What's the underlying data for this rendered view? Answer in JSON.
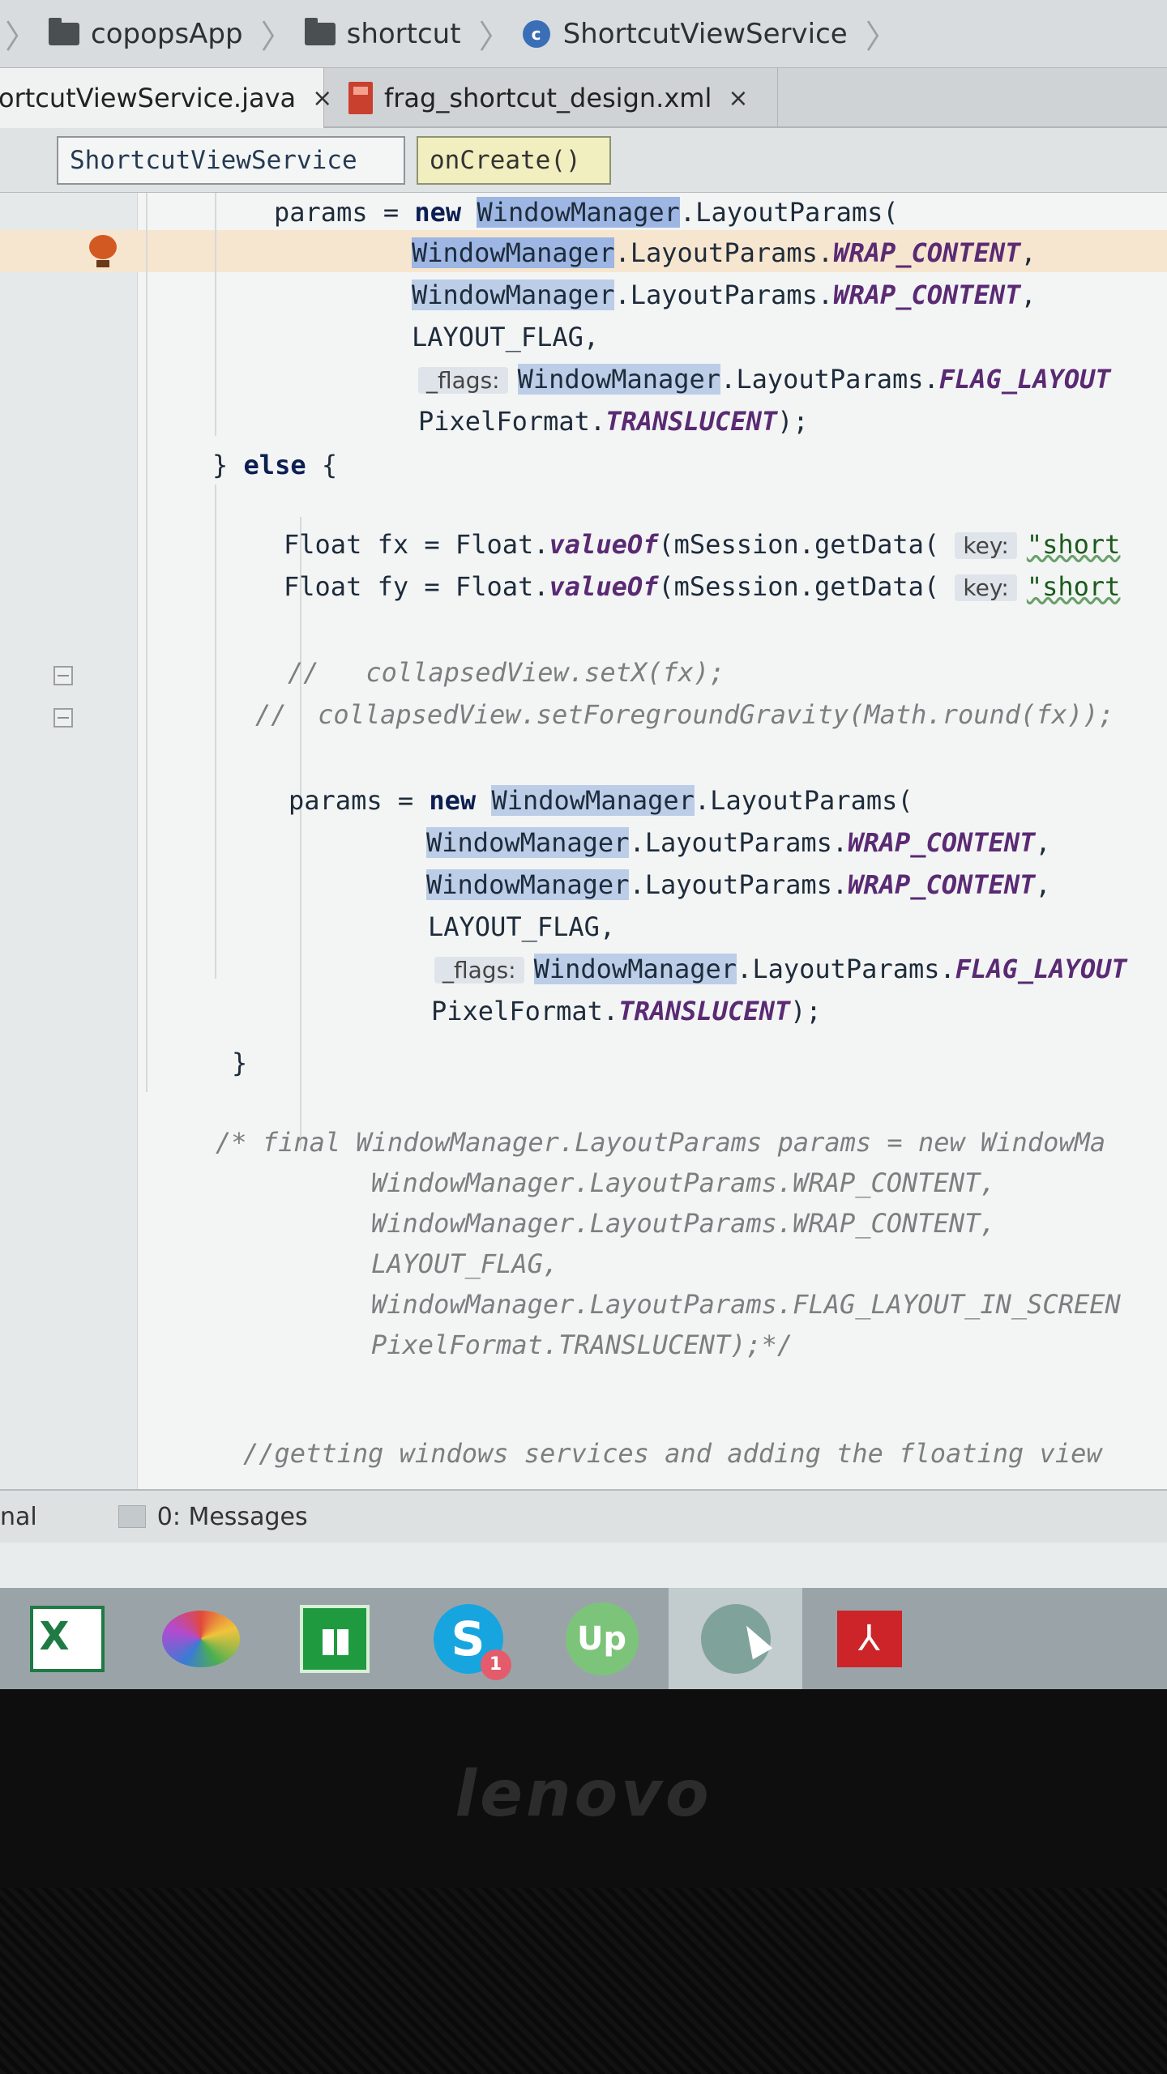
{
  "breadcrumbs": [
    "copopsApp",
    "shortcut",
    "ShortcutViewService"
  ],
  "tabs": [
    {
      "label": "ortcutViewService.java",
      "active": true
    },
    {
      "label": "frag_shortcut_design.xml",
      "active": false
    }
  ],
  "tab_close_glyph": "×",
  "structure": {
    "class": "ShortcutViewService",
    "method": "onCreate()"
  },
  "code": {
    "l1_var": "params",
    "l1_op": " = ",
    "l1_new": "new ",
    "l1_wm": "WindowManager",
    "l1_rest": ".LayoutParams(",
    "l2_wm1": "WindowM",
    "l2_wm2": "anager",
    "l2_mid": ".LayoutParams.",
    "l2_c": "WRAP_CONTENT",
    "l2_end": ",",
    "l3_wm": "WindowManager",
    "l3_mid": ".LayoutParams.",
    "l3_c": "WRAP_CONTENT",
    "l3_end": ",",
    "l4": "LAYOUT_FLAG,",
    "l5_hint": "_flags:",
    "l5_wm": "WindowManager",
    "l5_mid": ".LayoutParams.",
    "l5_c": "FLAG_LAYOUT",
    "l6_a": "PixelFormat.",
    "l6_c": "TRANSLUCENT",
    "l6_end": ");",
    "l7_a": "} ",
    "l7_else": "else",
    "l7_b": " {",
    "l8_a": "Float fx = Float.",
    "l8_m": "valueOf",
    "l8_b": "(mSession.getData(",
    "l8_hint": "key:",
    "l8_str": "\"short",
    "l9_a": "Float fy = Float.",
    "l9_m": "valueOf",
    "l9_b": "(mSession.getData(",
    "l9_hint": "key:",
    "l9_str": "\"short",
    "c1": "//   collapsedView.setX(fx);",
    "c2": "//  collapsedView.setForegroundGravity(Math.round(fx));",
    "m1_var": "params",
    "m1_op": " = ",
    "m1_new": "new ",
    "m1_wm": "WindowManager",
    "m1_rest": ".LayoutParams(",
    "m2_wm": "WindowManager",
    "m2_mid": ".LayoutParams.",
    "m2_c": "WRAP_CONTENT",
    "m2_end": ",",
    "m3_wm": "WindowManager",
    "m3_mid": ".LayoutParams.",
    "m3_c": "WRAP_CONTENT",
    "m3_end": ",",
    "m4": "LAYOUT_FLAG,",
    "m5_hint": "_flags:",
    "m5_wm": "WindowManager",
    "m5_mid": ".LayoutParams.",
    "m5_c": "FLAG_LAYOUT",
    "m6_a": "PixelFormat.",
    "m6_c": "TRANSLUCENT",
    "m6_end": ");",
    "close_brace": "}",
    "b1": "/* final WindowManager.LayoutParams params = new WindowMa",
    "b2": "WindowManager.LayoutParams.WRAP_CONTENT,",
    "b3": "WindowManager.LayoutParams.WRAP_CONTENT,",
    "b4": "LAYOUT_FLAG,",
    "b5": "WindowManager.LayoutParams.FLAG_LAYOUT_IN_SCREEN",
    "b6": "PixelFormat.TRANSLUCENT);*/",
    "last": "//getting windows services and adding the floating view"
  },
  "toolbar": {
    "terminal": "nal",
    "messages": "0: Messages"
  },
  "taskbar": {
    "apps": [
      "excel-icon",
      "paint-icon",
      "store-icon",
      "skype-icon",
      "upwork-icon",
      "android-studio-icon",
      "pdf-icon"
    ],
    "skype_badge": "1",
    "upwork_label": "Up",
    "skype_glyph": "S",
    "pdf_glyph": "⅄"
  },
  "brand": "lenovo"
}
